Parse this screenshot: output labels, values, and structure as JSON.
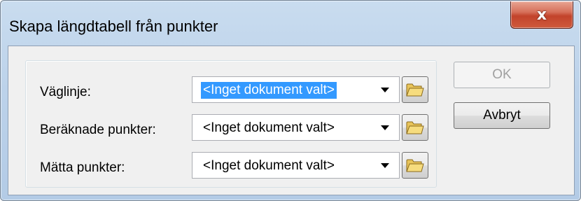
{
  "window": {
    "title": "Skapa längdtabell från punkter",
    "close_glyph": "x"
  },
  "form": {
    "rows": [
      {
        "label": "Väglinje:",
        "value": "<Inget dokument valt>",
        "selected": true
      },
      {
        "label": "Beräknade punkter:",
        "value": "<Inget dokument valt>",
        "selected": false
      },
      {
        "label": "Mätta punkter:",
        "value": "<Inget dokument valt>",
        "selected": false
      }
    ],
    "browse_icon": "folder-icon",
    "dropdown_icon": "chevron-down-icon"
  },
  "buttons": {
    "ok_label": "OK",
    "ok_enabled": false,
    "cancel_label": "Avbryt"
  },
  "colors": {
    "selection": "#3399ff",
    "close_button": "#c2432b",
    "title_bar": "#bcd2ea"
  }
}
